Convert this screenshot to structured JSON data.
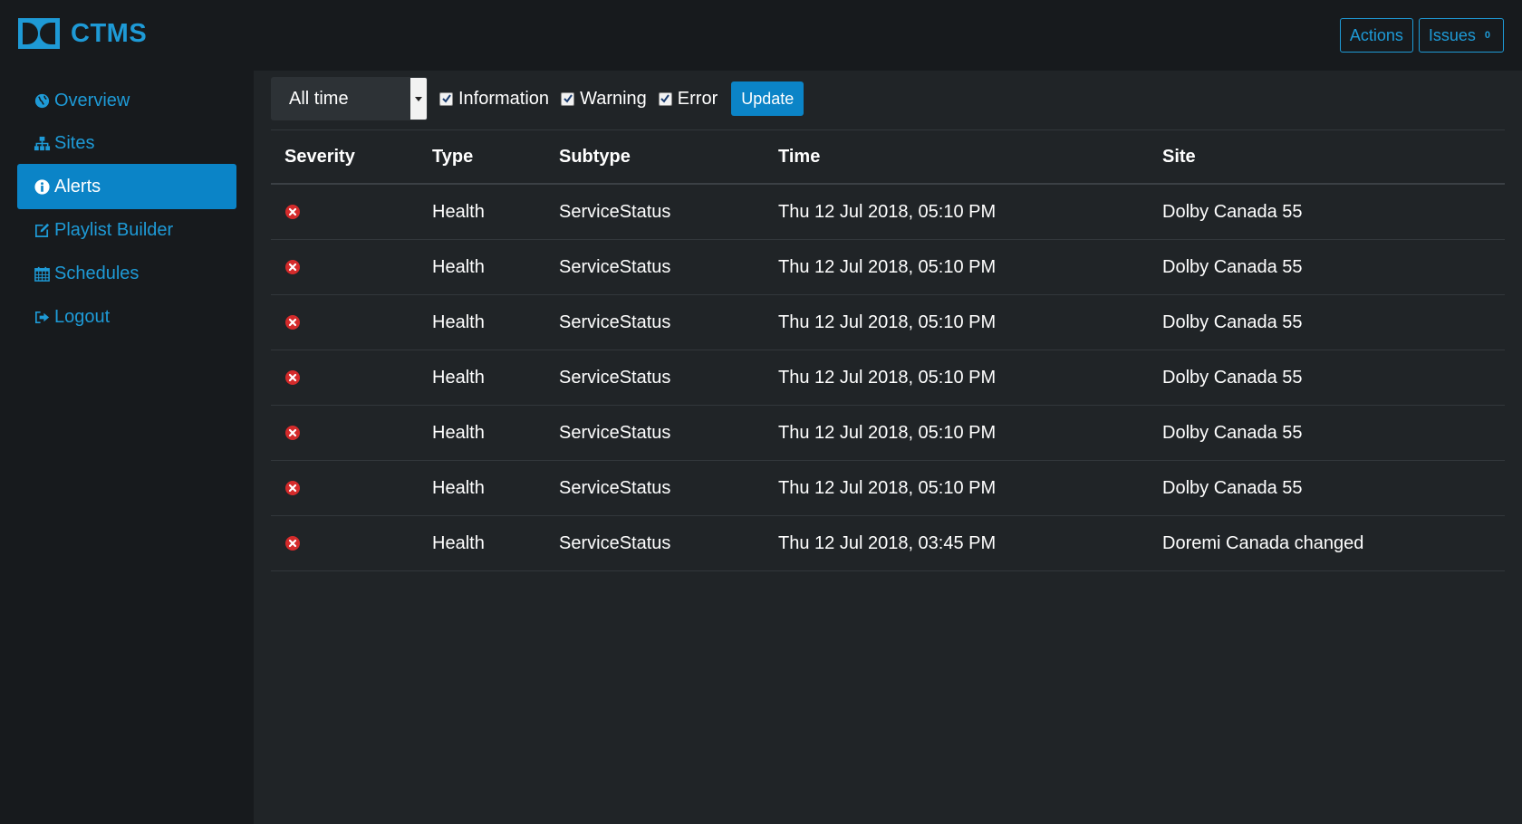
{
  "app": {
    "brand": "CTMS",
    "logo_icon": "dolby-logo-icon",
    "accent_color": "#1e9ad6",
    "active_color": "#0b84c7",
    "error_color": "#d42b2b"
  },
  "header": {
    "actions_label": "Actions",
    "issues_label": "Issues",
    "issues_count": "0"
  },
  "sidebar": {
    "items": [
      {
        "label": "Overview",
        "icon": "globe-icon",
        "active": false
      },
      {
        "label": "Sites",
        "icon": "sitemap-icon",
        "active": false
      },
      {
        "label": "Alerts",
        "icon": "info-circle-icon",
        "active": true
      },
      {
        "label": "Playlist Builder",
        "icon": "edit-icon",
        "active": false
      },
      {
        "label": "Schedules",
        "icon": "calendar-icon",
        "active": false
      },
      {
        "label": "Logout",
        "icon": "sign-out-icon",
        "active": false
      }
    ]
  },
  "filters": {
    "time_range": "All time",
    "information_label": "Information",
    "information_checked": true,
    "warning_label": "Warning",
    "warning_checked": true,
    "error_label": "Error",
    "error_checked": true,
    "update_label": "Update"
  },
  "table": {
    "columns": [
      "Severity",
      "Type",
      "Subtype",
      "Time",
      "Site"
    ],
    "rows": [
      {
        "severity": "error",
        "type": "Health",
        "subtype": "ServiceStatus",
        "time": "Thu 12 Jul 2018, 05:10 PM",
        "site": "Dolby Canada 55"
      },
      {
        "severity": "error",
        "type": "Health",
        "subtype": "ServiceStatus",
        "time": "Thu 12 Jul 2018, 05:10 PM",
        "site": "Dolby Canada 55"
      },
      {
        "severity": "error",
        "type": "Health",
        "subtype": "ServiceStatus",
        "time": "Thu 12 Jul 2018, 05:10 PM",
        "site": "Dolby Canada 55"
      },
      {
        "severity": "error",
        "type": "Health",
        "subtype": "ServiceStatus",
        "time": "Thu 12 Jul 2018, 05:10 PM",
        "site": "Dolby Canada 55"
      },
      {
        "severity": "error",
        "type": "Health",
        "subtype": "ServiceStatus",
        "time": "Thu 12 Jul 2018, 05:10 PM",
        "site": "Dolby Canada 55"
      },
      {
        "severity": "error",
        "type": "Health",
        "subtype": "ServiceStatus",
        "time": "Thu 12 Jul 2018, 05:10 PM",
        "site": "Dolby Canada 55"
      },
      {
        "severity": "error",
        "type": "Health",
        "subtype": "ServiceStatus",
        "time": "Thu 12 Jul 2018, 03:45 PM",
        "site": "Doremi Canada changed"
      }
    ]
  }
}
